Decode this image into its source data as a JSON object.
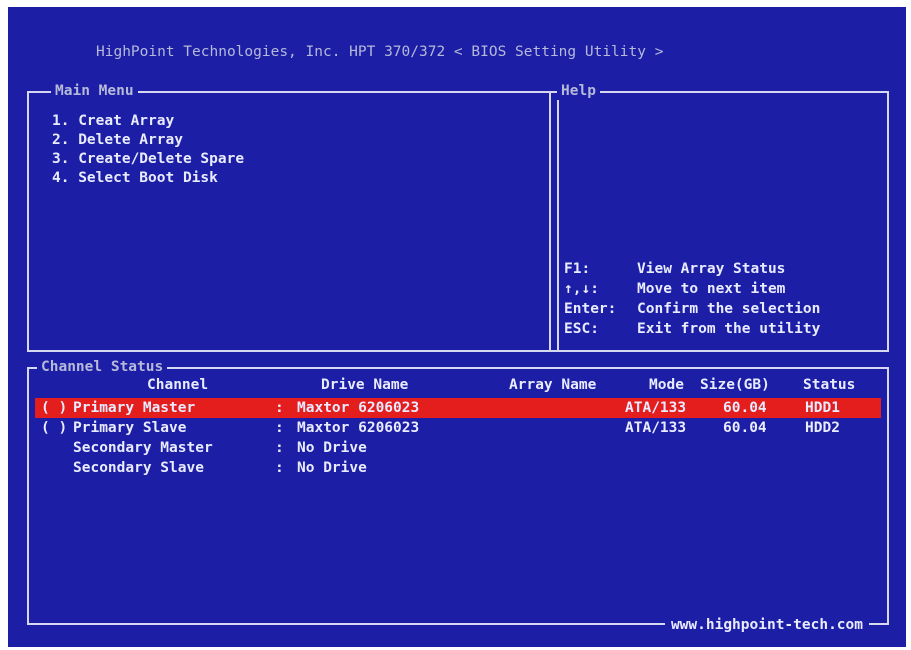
{
  "title": "HighPoint Technologies, Inc. HPT 370/372 < BIOS Setting Utility >",
  "main_menu": {
    "label": "Main Menu",
    "items": [
      "1. Creat Array",
      "2. Delete Array",
      "3. Create/Delete Spare",
      "4. Select Boot Disk"
    ]
  },
  "help": {
    "label": "Help",
    "items": [
      {
        "key": "F1:",
        "desc": "View Array Status"
      },
      {
        "key": "↑,↓:",
        "desc": "Move to next item"
      },
      {
        "key": "Enter:",
        "desc": "Confirm the selection"
      },
      {
        "key": "ESC:",
        "desc": "Exit from the utility"
      }
    ]
  },
  "channel_status": {
    "label": "Channel Status",
    "headers": {
      "channel": "Channel",
      "drive_name": "Drive Name",
      "array_name": "Array Name",
      "mode": "Mode",
      "size": "Size(GB)",
      "status": "Status"
    },
    "rows": [
      {
        "marker": "( )",
        "channel": "Primary Master",
        "sep": ":",
        "drive": "Maxtor 6206023",
        "array": "",
        "mode": "ATA/133",
        "size": "60.04",
        "status": "HDD1"
      },
      {
        "marker": "( )",
        "channel": "Primary Slave",
        "sep": ":",
        "drive": "Maxtor 6206023",
        "array": "",
        "mode": "ATA/133",
        "size": "60.04",
        "status": "HDD2"
      },
      {
        "marker": "",
        "channel": "Secondary Master",
        "sep": ":",
        "drive": "No Drive",
        "array": "",
        "mode": "",
        "size": "",
        "status": ""
      },
      {
        "marker": "",
        "channel": "Secondary Slave",
        "sep": ":",
        "drive": "No Drive",
        "array": "",
        "mode": "",
        "size": "",
        "status": ""
      }
    ]
  },
  "footer_url": "www.highpoint-tech.com",
  "colors": {
    "background": "#1c1fa6",
    "highlight": "#e41d1d",
    "text": "#e9ebff"
  }
}
